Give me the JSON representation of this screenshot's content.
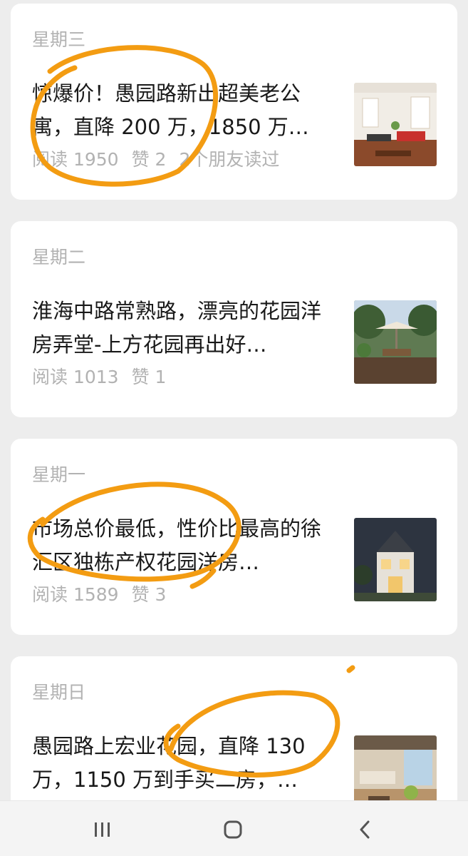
{
  "articles": [
    {
      "day": "星期三",
      "title": "惊爆价！愚园路新出超美老公寓，直降 200 万，1850 万…",
      "reads": "阅读 1950",
      "likes": "赞 2",
      "friends": "2个朋友读过",
      "thumb_icon": "living-room-photo"
    },
    {
      "day": "星期二",
      "title": "淮海中路常熟路，漂亮的花园洋房弄堂-上方花园再出好…",
      "reads": "阅读 1013",
      "likes": "赞 1",
      "friends": "",
      "thumb_icon": "garden-patio-photo"
    },
    {
      "day": "星期一",
      "title": "市场总价最低，性价比最高的徐汇区独栋产权花园洋房…",
      "reads": "阅读 1589",
      "likes": "赞 3",
      "friends": "",
      "thumb_icon": "villa-exterior-photo"
    },
    {
      "day": "星期日",
      "title": "愚园路上宏业花园，直降 130 万，1150 万到手买二房，…",
      "reads": "",
      "likes": "",
      "friends": "",
      "thumb_icon": "lounge-interior-photo"
    }
  ],
  "navbar": {
    "recent_icon": "recent-apps-icon",
    "home_icon": "home-icon",
    "back_icon": "back-icon"
  },
  "colors": {
    "highlight": "#f39c12",
    "background": "#ededed",
    "card": "#ffffff",
    "muted_text": "#b2b2b2",
    "title_text": "#191919"
  }
}
